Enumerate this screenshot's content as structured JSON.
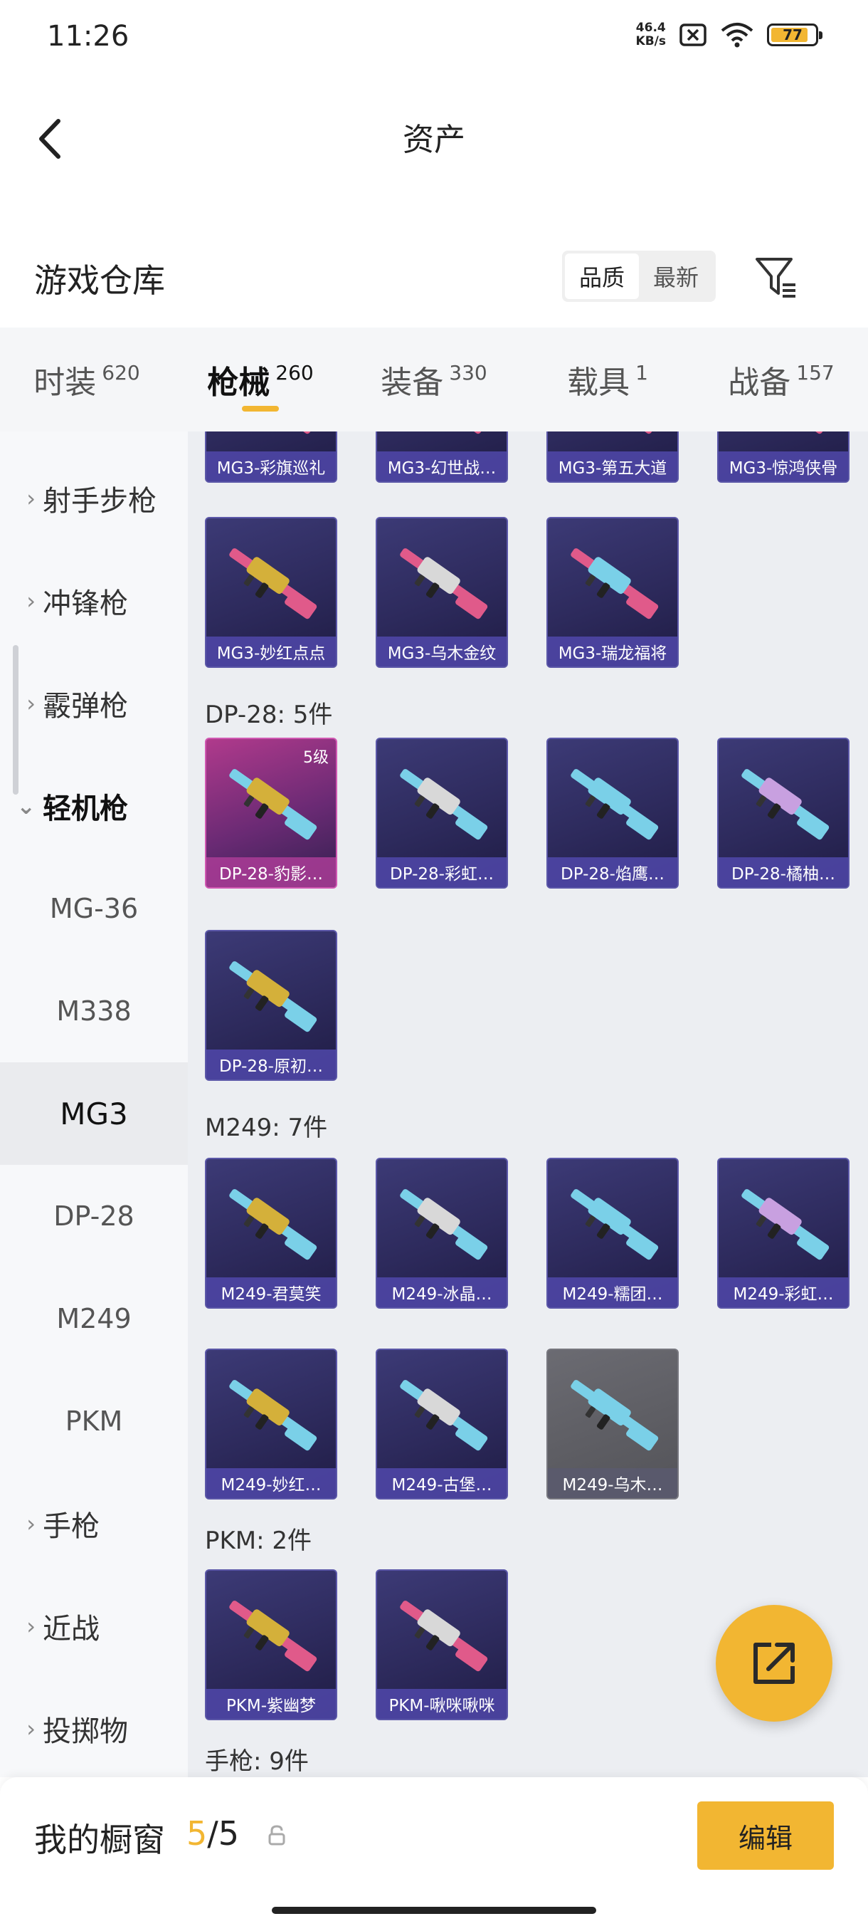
{
  "status": {
    "time": "11:26",
    "net_speed_value": "46.4",
    "net_speed_unit": "KB/s",
    "battery": "77",
    "battery_level": 0.77
  },
  "nav": {
    "title": "资产"
  },
  "warehouse": {
    "title": "游戏仓库",
    "sort_quality": "品质",
    "sort_newest": "最新"
  },
  "tabs": [
    {
      "label": "时装",
      "count": "620"
    },
    {
      "label": "枪械",
      "count": "260"
    },
    {
      "label": "装备",
      "count": "330"
    },
    {
      "label": "载具",
      "count": "1"
    },
    {
      "label": "战备",
      "count": "157"
    }
  ],
  "sidebar": {
    "sniper": "射手步枪",
    "smg": "冲锋枪",
    "shotgun": "霰弹枪",
    "lmg": "轻机枪",
    "sub": [
      "MG-36",
      "M338",
      "MG3",
      "DP-28",
      "M249",
      "PKM"
    ],
    "pistol": "手枪",
    "melee": "近战",
    "throwable": "投掷物"
  },
  "sections": {
    "mg3_items": [
      "MG3-彩旗巡礼",
      "MG3-幻世战…",
      "MG3-第五大道",
      "MG3-惊鸿侠骨",
      "MG3-妙红点点",
      "MG3-乌木金纹",
      "MG3-瑞龙福将"
    ],
    "dp28_title": "DP-28: 5件",
    "dp28_items": [
      "DP-28-豹影…",
      "DP-28-彩虹…",
      "DP-28-焰鹰…",
      "DP-28-橘柚…",
      "DP-28-原初…"
    ],
    "dp28_level": "5级",
    "m249_title": "M249: 7件",
    "m249_items": [
      "M249-君莫笑",
      "M249-冰晶…",
      "M249-糯团…",
      "M249-彩虹…",
      "M249-妙红…",
      "M249-古堡…",
      "M249-乌木…"
    ],
    "pkm_title": "PKM: 2件",
    "pkm_items": [
      "PKM-紫幽梦",
      "PKM-啾咪啾咪"
    ],
    "pistol_title": "手枪: 9件"
  },
  "showcase": {
    "label": "我的橱窗",
    "current": "5",
    "total": "/5",
    "edit": "编辑"
  },
  "colors": {
    "accent": "#f2b632",
    "card_bg": "#2d2a5c",
    "card_caption": "#5048aa"
  },
  "icons": [
    "back-icon",
    "filter-icon",
    "share-icon",
    "lock-icon",
    "wifi-icon",
    "sim-off-icon",
    "battery-icon"
  ]
}
